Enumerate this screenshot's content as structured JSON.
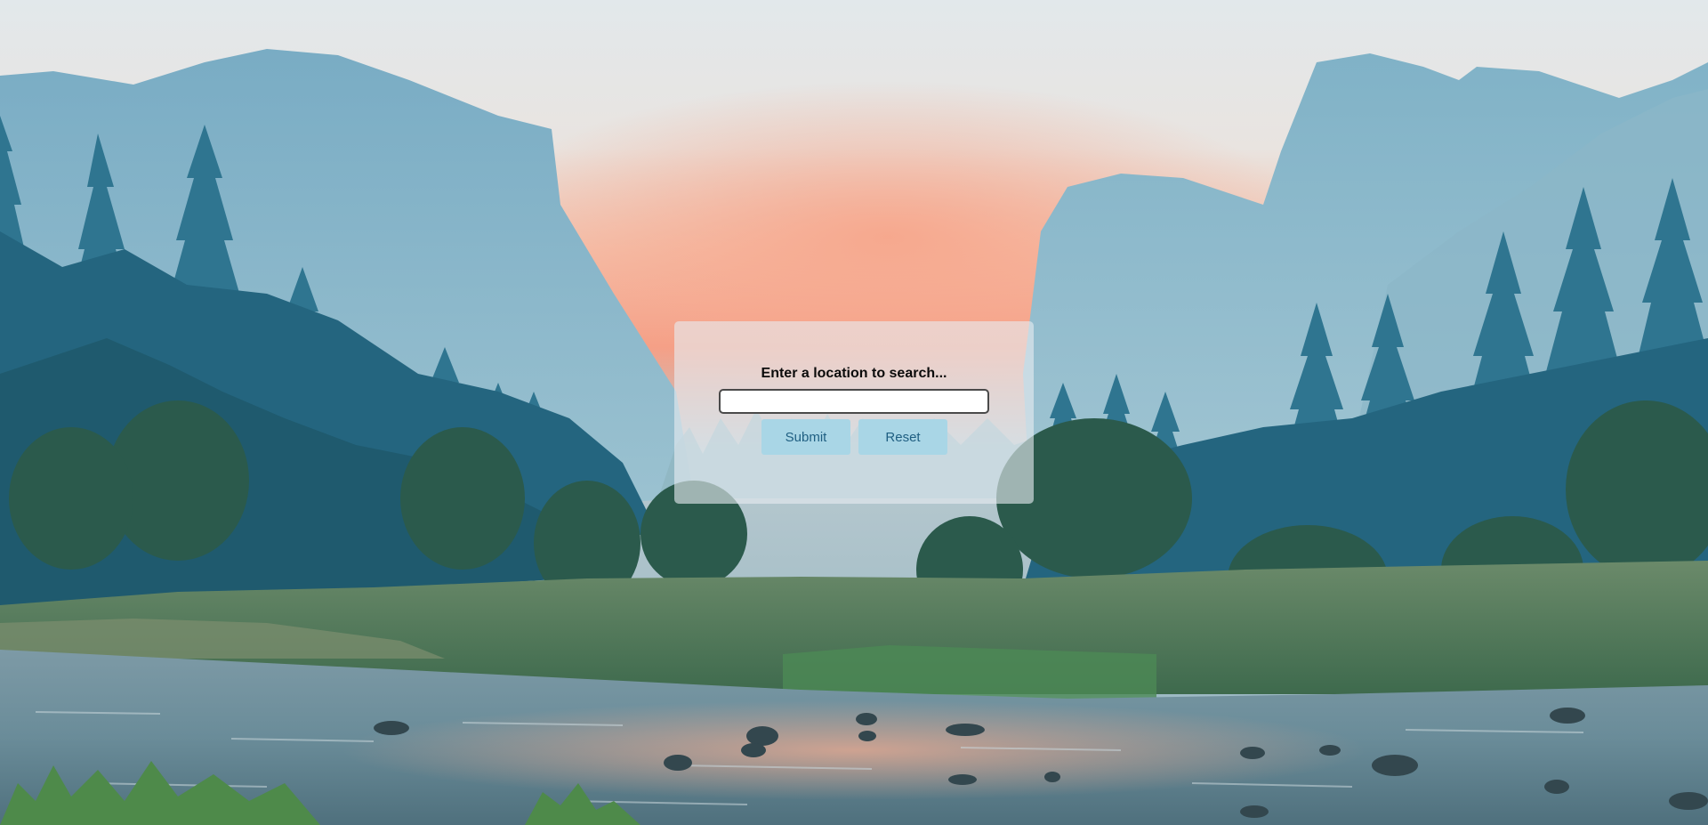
{
  "search": {
    "prompt": "Enter a location to search...",
    "value": "",
    "placeholder": ""
  },
  "buttons": {
    "submit": "Submit",
    "reset": "Reset"
  },
  "background": {
    "description_icon": "valley-landscape-background",
    "colors": {
      "sky_top": "#dfe7ea",
      "sky_glow": "#f2a48a",
      "mountain": "#7fb0c6",
      "forest": "#2b6f86",
      "water": "#5f8291"
    }
  }
}
